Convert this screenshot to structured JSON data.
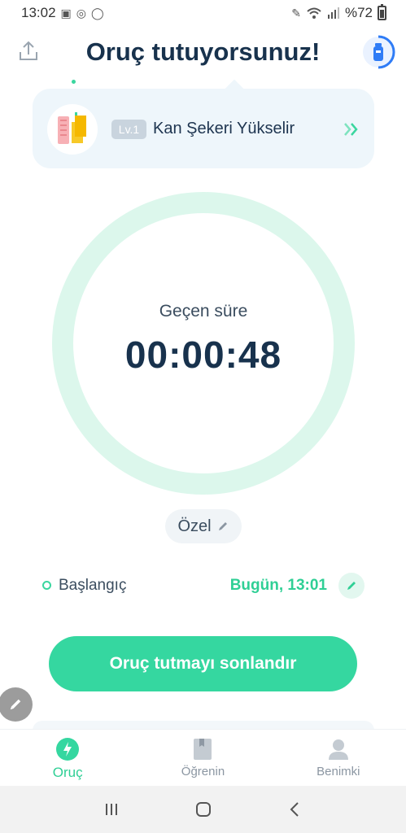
{
  "status_bar": {
    "time": "13:02",
    "battery_text": "%72",
    "battery_level": 0.72
  },
  "header": {
    "title": "Oruç tutuyorsunuz!"
  },
  "level_card": {
    "badge": "Lv.1",
    "label": "Kan Şekeri Yükselir"
  },
  "timer": {
    "label": "Geçen süre",
    "elapsed": "00:00:48"
  },
  "plan": {
    "label": "Özel"
  },
  "start": {
    "label": "Başlangıç",
    "value": "Bugün, 13:01"
  },
  "actions": {
    "end_fast_label": "Oruç tutmayı sonlandır"
  },
  "bottom_nav": {
    "items": [
      {
        "label": "Oruç",
        "icon": "lightning-icon",
        "active": true
      },
      {
        "label": "Öğrenin",
        "icon": "book-icon",
        "active": false
      },
      {
        "label": "Benimki",
        "icon": "person-icon",
        "active": false
      }
    ]
  },
  "colors": {
    "accent": "#35d7a0",
    "title": "#18324d",
    "ring": "#dcf7ec",
    "card_bg": "#eef6fb"
  }
}
